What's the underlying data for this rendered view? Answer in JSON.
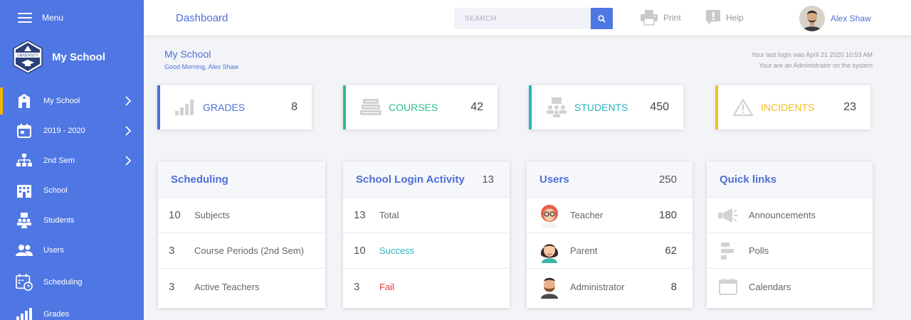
{
  "sidebar": {
    "menu_label": "Menu",
    "brand_name": "My School",
    "logo_text": "UNIVERSITY",
    "items": [
      {
        "label": "My School",
        "icon": "school-building-icon",
        "active": true,
        "chevron": true
      },
      {
        "label": "2019 - 2020",
        "icon": "calendar-icon",
        "chevron": true
      },
      {
        "label": "2nd Sem",
        "icon": "hierarchy-icon",
        "chevron": true
      },
      {
        "label": "School",
        "icon": "building-icon"
      },
      {
        "label": "Students",
        "icon": "students-icon"
      },
      {
        "label": "Users",
        "icon": "users-icon"
      },
      {
        "label": "Scheduling",
        "icon": "schedule-icon"
      },
      {
        "label": "Grades",
        "icon": "bar-chart-icon"
      }
    ]
  },
  "topbar": {
    "title": "Dashboard",
    "search_placeholder": "SEARCH",
    "print_label": "Print",
    "help_label": "Help",
    "user_name": "Alex Shaw"
  },
  "page": {
    "title": "My School",
    "greeting": "Good Morning, Alex Shaw",
    "last_login": "Your last login was April 21 2020 10:53 AM",
    "role_text": "Your are an Administrator on the system"
  },
  "stats": [
    {
      "label": "GRADES",
      "value": "8",
      "color": "#4f6fd6"
    },
    {
      "label": "COURSES",
      "value": "42",
      "color": "#2bbf8a"
    },
    {
      "label": "STUDENTS",
      "value": "450",
      "color": "#2bb3c0"
    },
    {
      "label": "INCIDENTS",
      "value": "23",
      "color": "#f4c01e"
    }
  ],
  "scheduling": {
    "title": "Scheduling",
    "rows": [
      {
        "num": "10",
        "label": "Subjects"
      },
      {
        "num": "3",
        "label": "Course Periods (2nd Sem)"
      },
      {
        "num": "3",
        "label": "Active Teachers"
      }
    ]
  },
  "login_activity": {
    "title": "School Login Activity",
    "count": "13",
    "rows": [
      {
        "num": "13",
        "label": "Total",
        "color": "#666666"
      },
      {
        "num": "10",
        "label": "Success",
        "color": "#2bb3c0"
      },
      {
        "num": "3",
        "label": "Fail",
        "color": "#e53935"
      }
    ]
  },
  "users": {
    "title": "Users",
    "count": "250",
    "rows": [
      {
        "label": "Teacher",
        "value": "180",
        "avatar": "teacher-avatar"
      },
      {
        "label": "Parent",
        "value": "62",
        "avatar": "parent-avatar"
      },
      {
        "label": "Administrator",
        "value": "8",
        "avatar": "administrator-avatar"
      }
    ]
  },
  "quick_links": {
    "title": "Quick links",
    "rows": [
      {
        "label": "Announcements",
        "icon": "megaphone-icon"
      },
      {
        "label": "Polls",
        "icon": "poll-icon"
      },
      {
        "label": "Calendars",
        "icon": "calendar-icon"
      }
    ]
  }
}
